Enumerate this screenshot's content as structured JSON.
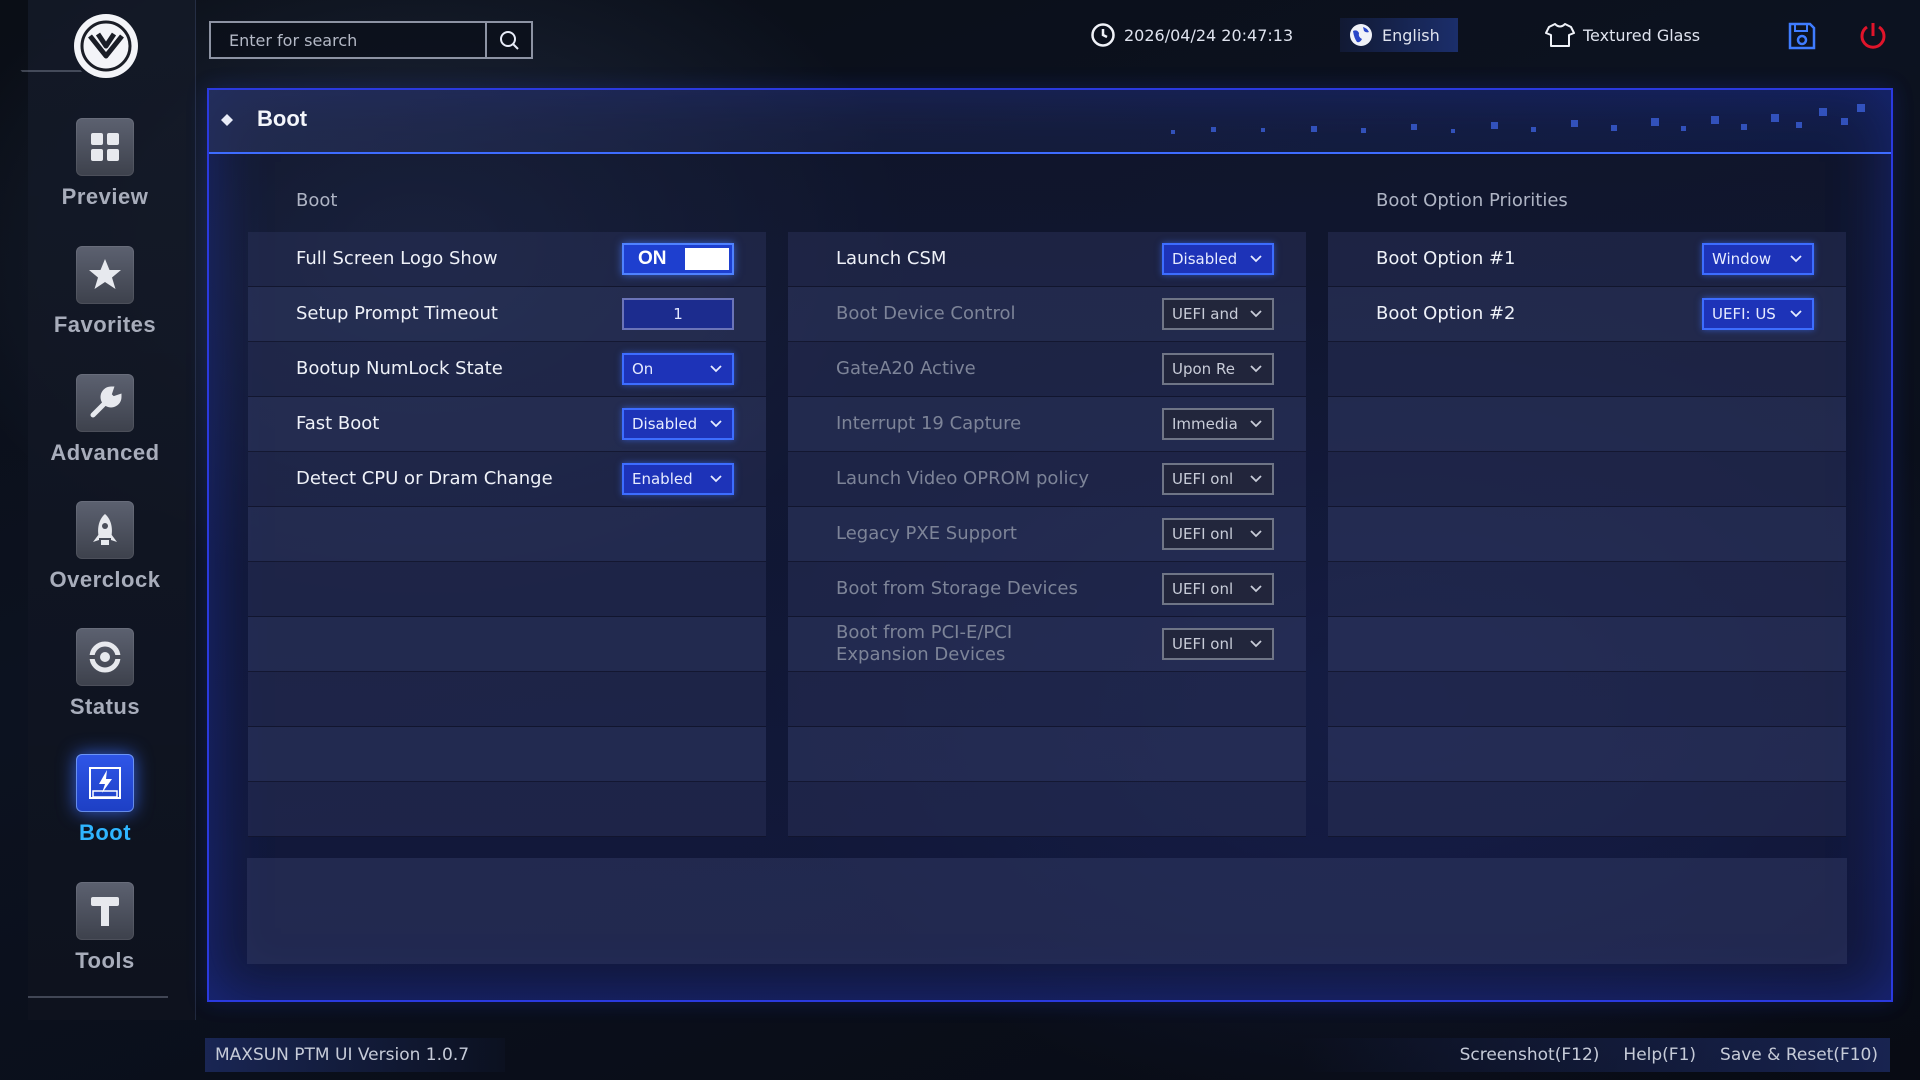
{
  "search": {
    "placeholder": "Enter for search"
  },
  "header": {
    "datetime": "2026/04/24 20:47:13",
    "language": "English",
    "theme": "Textured Glass"
  },
  "sidebar": {
    "items": [
      {
        "label": "Preview",
        "icon": "grid-icon"
      },
      {
        "label": "Favorites",
        "icon": "star-icon"
      },
      {
        "label": "Advanced",
        "icon": "wrench-icon"
      },
      {
        "label": "Overclock",
        "icon": "rocket-icon"
      },
      {
        "label": "Status",
        "icon": "status-icon"
      },
      {
        "label": "Boot",
        "icon": "boot-icon",
        "active": true
      },
      {
        "label": "Tools",
        "icon": "hammer-icon"
      }
    ]
  },
  "panel": {
    "title": "Boot"
  },
  "left": {
    "section_title": "Boot",
    "rows": [
      {
        "label": "Full Screen Logo Show",
        "type": "toggle",
        "value": "ON"
      },
      {
        "label": "Setup Prompt Timeout",
        "type": "number",
        "value": "1"
      },
      {
        "label": "Bootup NumLock State",
        "type": "select",
        "value": "On"
      },
      {
        "label": "Fast Boot",
        "type": "select",
        "value": "Disabled"
      },
      {
        "label": "Detect CPU or Dram Change",
        "type": "select",
        "value": "Enabled"
      }
    ]
  },
  "middle": {
    "rows": [
      {
        "label": "Launch CSM",
        "value": "Disabled",
        "enabled": true
      },
      {
        "label": "Boot Device Control",
        "value": "UEFI and",
        "enabled": false
      },
      {
        "label": "GateA20 Active",
        "value": "Upon Re",
        "enabled": false
      },
      {
        "label": "Interrupt 19 Capture",
        "value": "Immedia",
        "enabled": false
      },
      {
        "label": "Launch Video OPROM policy",
        "value": "UEFI onl",
        "enabled": false
      },
      {
        "label": "Legacy PXE Support",
        "value": "UEFI onl",
        "enabled": false
      },
      {
        "label": "Boot from Storage Devices",
        "value": "UEFI onl",
        "enabled": false
      },
      {
        "label_line1": "Boot from PCI-E/PCI",
        "label_line2": "Expansion Devices",
        "value": "UEFI onl",
        "enabled": false
      }
    ]
  },
  "right": {
    "section_title": "Boot Option Priorities",
    "rows": [
      {
        "label": "Boot Option #1",
        "value": "Window"
      },
      {
        "label": "Boot Option #2",
        "value": "UEFI: US"
      }
    ]
  },
  "footer": {
    "version": "MAXSUN PTM UI Version 1.0.7",
    "screenshot": "Screenshot(F12)",
    "help": "Help(F1)",
    "save_reset": "Save & Reset(F10)"
  },
  "colors": {
    "accent": "#2b3ae0",
    "active_nav": "#2fb5ff",
    "power": "#e0142a"
  }
}
